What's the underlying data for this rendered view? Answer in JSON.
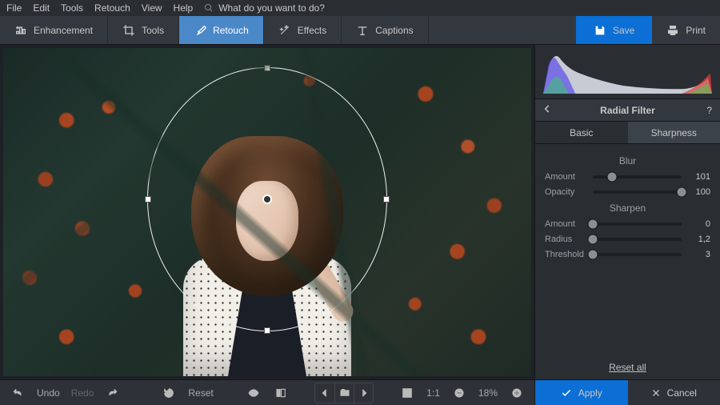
{
  "menubar": {
    "items": [
      "File",
      "Edit",
      "Tools",
      "Retouch",
      "View",
      "Help"
    ],
    "search_placeholder": "What do you want to do?"
  },
  "toolbar": {
    "tabs": [
      {
        "label": "Enhancement",
        "icon": "enhancement-icon"
      },
      {
        "label": "Tools",
        "icon": "crop-icon"
      },
      {
        "label": "Retouch",
        "icon": "brush-icon",
        "active": true
      },
      {
        "label": "Effects",
        "icon": "wand-icon"
      },
      {
        "label": "Captions",
        "icon": "text-icon"
      }
    ],
    "save": "Save",
    "print": "Print"
  },
  "bottombar": {
    "undo": "Undo",
    "redo": "Redo",
    "reset": "Reset",
    "ratio": "1:1",
    "zoom": "18%"
  },
  "panel": {
    "title": "Radial Filter",
    "subtabs": [
      {
        "label": "Basic"
      },
      {
        "label": "Sharpness",
        "active": true
      }
    ],
    "sections": [
      {
        "label": "Blur",
        "sliders": [
          {
            "label": "Amount",
            "value": "101",
            "pos": 22
          },
          {
            "label": "Opacity",
            "value": "100",
            "pos": 100
          }
        ]
      },
      {
        "label": "Sharpen",
        "sliders": [
          {
            "label": "Amount",
            "value": "0",
            "pos": 0
          },
          {
            "label": "Radius",
            "value": "1,2",
            "pos": 0
          },
          {
            "label": "Threshold",
            "value": "3",
            "pos": 0
          }
        ]
      }
    ],
    "reset_all": "Reset all",
    "apply": "Apply",
    "cancel": "Cancel"
  }
}
